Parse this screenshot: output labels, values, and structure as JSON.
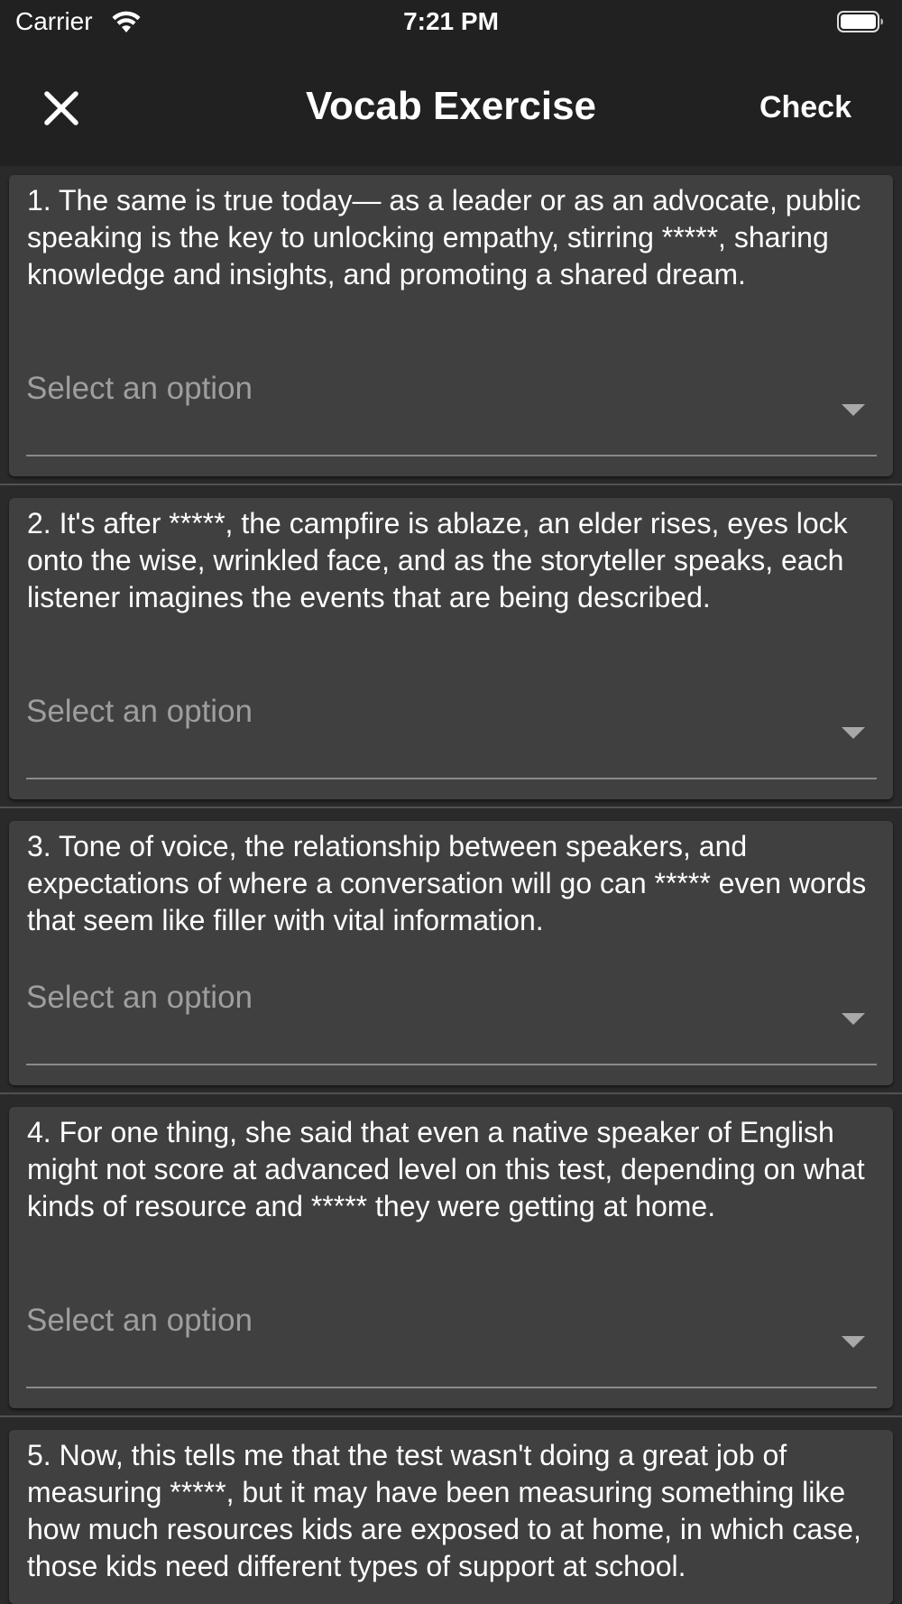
{
  "status_bar": {
    "carrier": "Carrier",
    "time": "7:21 PM",
    "wifi_icon": "wifi-icon",
    "battery_icon": "battery-icon"
  },
  "app_bar": {
    "title": "Vocab Exercise",
    "close_icon": "close-icon",
    "check_label": "Check"
  },
  "colors": {
    "background": "#2a2a2a",
    "app_bar": "#212121",
    "card": "#404040",
    "placeholder": "#9e9e9e",
    "text": "#ffffff"
  },
  "questions": [
    {
      "text": "1. The same is true today— as a leader or as an advocate, public speaking is the key  to unlocking empathy, stirring *****, sharing knowledge and insights,  and promoting a shared dream.",
      "placeholder": "Select an option"
    },
    {
      "text": "2. It's after *****, the campfire  is ablaze, an elder rises, eyes lock  onto the wise, wrinkled face, and as the storyteller speaks, each listener imagines the events that are being described.",
      "placeholder": "Select an option"
    },
    {
      "text": "3. Tone of voice,  the relationship between speakers, and expectations of where  a conversation will go can ***** even words that seem like filler with vital information.",
      "placeholder": "Select an option"
    },
    {
      "text": "4. For one thing, she said that even a native speaker of English might not score at advanced level on this test, depending on what kinds of resource and ***** they were getting at home.",
      "placeholder": "Select an option"
    },
    {
      "text": "5. Now, this tells me that the test wasn't doing a great job of measuring *****, but it may have been measuring something like how much resources kids are exposed to at home, in which case, those kids need different types of support at school.",
      "placeholder": "Select an option"
    }
  ]
}
